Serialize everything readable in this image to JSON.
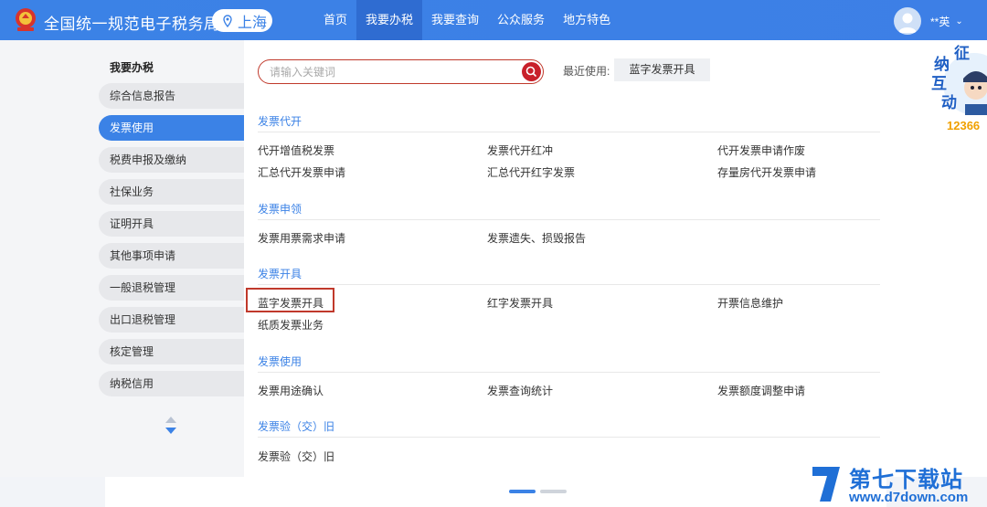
{
  "header": {
    "site_title": "全国统一规范电子税务局",
    "region": "上海",
    "nav": [
      "首页",
      "我要办税",
      "我要查询",
      "公众服务",
      "地方特色"
    ],
    "active_nav": "我要办税",
    "user_name": "**英"
  },
  "sidebar": {
    "title": "我要办税",
    "items": [
      "综合信息报告",
      "发票使用",
      "税费申报及缴纳",
      "社保业务",
      "证明开具",
      "其他事项申请",
      "一般退税管理",
      "出口退税管理",
      "核定管理",
      "纳税信用"
    ],
    "active_item": "发票使用"
  },
  "search": {
    "placeholder": "请输入关键词"
  },
  "recent": {
    "label": "最近使用:",
    "item": "蓝字发票开具"
  },
  "sections": [
    {
      "title": "发票代开",
      "links": [
        "代开增值税发票",
        "发票代开红冲",
        "代开发票申请作废",
        "汇总代开发票申请",
        "汇总代开红字发票",
        "存量房代开发票申请"
      ]
    },
    {
      "title": "发票申领",
      "links": [
        "发票用票需求申请",
        "发票遗失、损毁报告"
      ]
    },
    {
      "title": "发票开具",
      "links": [
        "蓝字发票开具",
        "红字发票开具",
        "开票信息维护",
        "纸质发票业务"
      ]
    },
    {
      "title": "发票使用",
      "links": [
        "发票用途确认",
        "发票查询统计",
        "发票额度调整申请"
      ]
    },
    {
      "title": "发票验（交）旧",
      "links": [
        "发票验（交）旧"
      ]
    }
  ],
  "widget": {
    "text": [
      "征",
      "纳",
      "互",
      "动"
    ],
    "badge": "12366"
  },
  "watermark": {
    "title": "第七下载站",
    "url": "www.d7down.com"
  },
  "colors": {
    "primary": "#3b82e6",
    "active_nav": "#2f6cd1",
    "accent_red": "#c8202a",
    "link_blue": "#3b82e6"
  }
}
